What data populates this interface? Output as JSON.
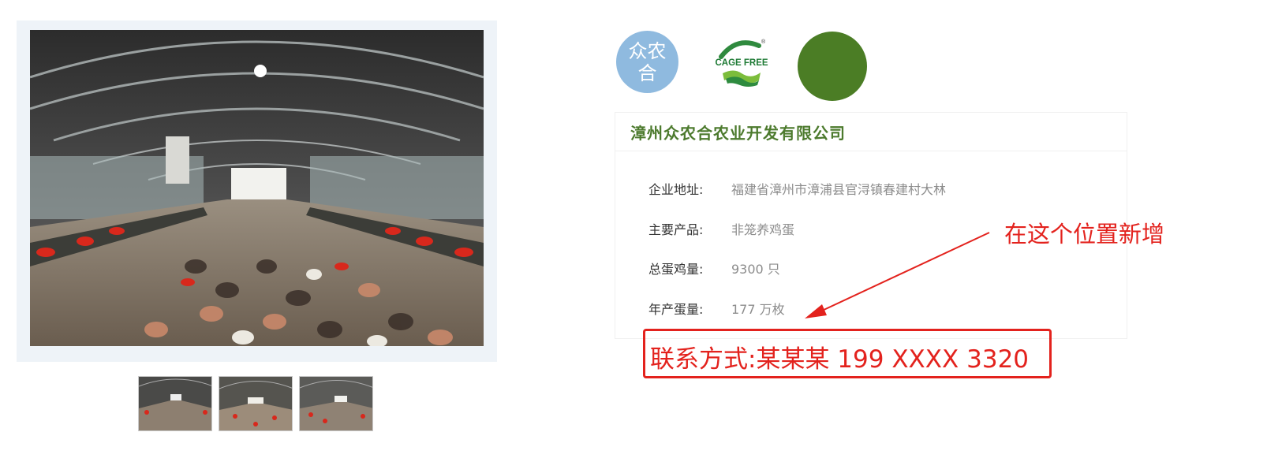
{
  "gallery": {
    "main_photo_alt": "",
    "thumbnails": [
      "",
      "",
      ""
    ]
  },
  "logos": {
    "zhongnonghe_line1": "众农",
    "zhongnonghe_line2": "合",
    "cage_free_text": "CAGE FREE",
    "cage_free_reg": "®"
  },
  "company": {
    "name": "漳州众农合农业开发有限公司",
    "rows": [
      {
        "label": "企业地址:",
        "value": "福建省漳州市漳浦县官浔镇春建村大林"
      },
      {
        "label": "主要产品:",
        "value": "非笼养鸡蛋"
      },
      {
        "label": "总蛋鸡量:",
        "value": "9300 只"
      },
      {
        "label": "年产蛋量:",
        "value": "177 万枚"
      }
    ]
  },
  "annotation": {
    "contact": "联系方式:某某某 199 XXXX 3320",
    "note": "在这个位置新增",
    "color": "#e3221d"
  },
  "colors": {
    "brand_green": "#4c7a2d",
    "logo_blue": "#8fbadf",
    "logo_dark_green": "#4b7d25"
  }
}
